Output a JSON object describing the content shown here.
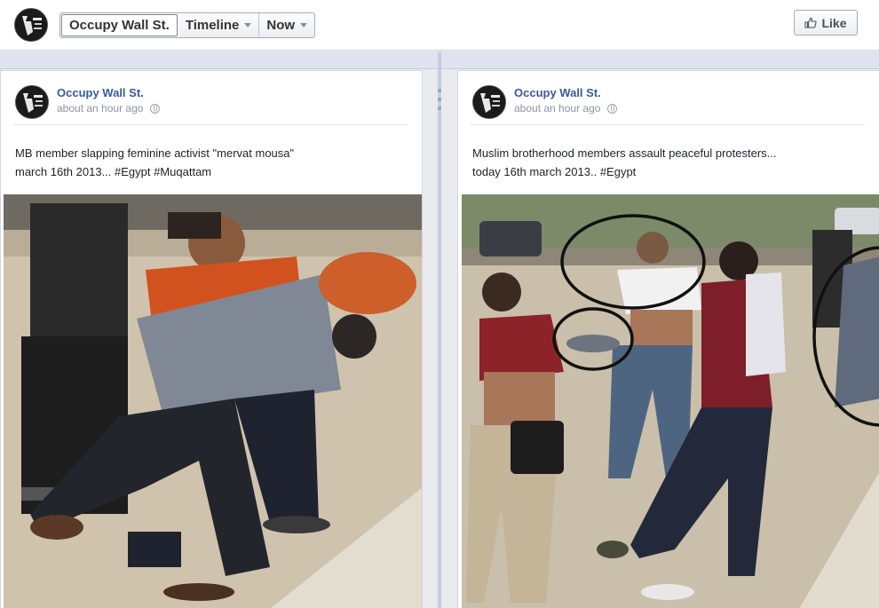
{
  "header": {
    "page_name": "Occupy Wall St.",
    "timeline_label": "Timeline",
    "now_label": "Now",
    "like_label": "Like",
    "like_icon": "thumbs-up-icon"
  },
  "posts": [
    {
      "author": "Occupy Wall St.",
      "time": "about an hour ago",
      "audience_icon": "globe-icon",
      "text_line1": "MB member slapping feminine activist \"mervat mousa\"",
      "text_line2": "march 16th 2013... #Egypt #Muqattam"
    },
    {
      "author": "Occupy Wall St.",
      "time": "about an hour ago",
      "audience_icon": "globe-icon",
      "text_line1": "Muslim brotherhood members assault peaceful protesters...",
      "text_line2": "today 16th march 2013.. #Egypt"
    }
  ],
  "colors": {
    "link_blue": "#3b5998",
    "timeline_bg": "#dfe3ee",
    "page_bg": "#e9ebee"
  }
}
